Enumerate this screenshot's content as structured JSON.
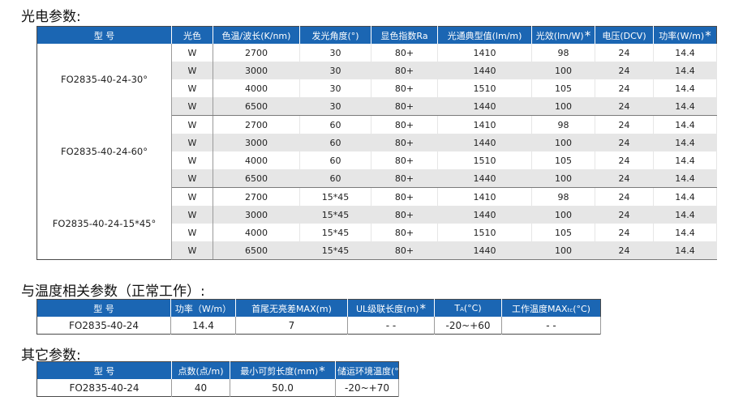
{
  "optical": {
    "title": "光电参数:",
    "headers": [
      "型 号",
      "光色",
      "色温/波长(K/nm)",
      "发光角度(°)",
      "显色指数Ra",
      "光通典型值(lm/m)",
      "光效(lm/W)",
      "电压(DCV)",
      "功率(W/m)"
    ],
    "star_glyph": "*",
    "groups": [
      {
        "model": "FO2835-40-24-30°",
        "rows": [
          [
            "W",
            "2700",
            "30",
            "80+",
            "1410",
            "98",
            "24",
            "14.4"
          ],
          [
            "W",
            "3000",
            "30",
            "80+",
            "1440",
            "100",
            "24",
            "14.4"
          ],
          [
            "W",
            "4000",
            "30",
            "80+",
            "1510",
            "105",
            "24",
            "14.4"
          ],
          [
            "W",
            "6500",
            "30",
            "80+",
            "1440",
            "100",
            "24",
            "14.4"
          ]
        ]
      },
      {
        "model": "FO2835-40-24-60°",
        "rows": [
          [
            "W",
            "2700",
            "60",
            "80+",
            "1410",
            "98",
            "24",
            "14.4"
          ],
          [
            "W",
            "3000",
            "60",
            "80+",
            "1440",
            "100",
            "24",
            "14.4"
          ],
          [
            "W",
            "4000",
            "60",
            "80+",
            "1510",
            "105",
            "24",
            "14.4"
          ],
          [
            "W",
            "6500",
            "60",
            "80+",
            "1440",
            "100",
            "24",
            "14.4"
          ]
        ]
      },
      {
        "model": "FO2835-40-24-15*45°",
        "rows": [
          [
            "W",
            "2700",
            "15*45",
            "80+",
            "1410",
            "98",
            "24",
            "14.4"
          ],
          [
            "W",
            "3000",
            "15*45",
            "80+",
            "1440",
            "100",
            "24",
            "14.4"
          ],
          [
            "W",
            "4000",
            "15*45",
            "80+",
            "1510",
            "105",
            "24",
            "14.4"
          ],
          [
            "W",
            "6500",
            "15*45",
            "80+",
            "1440",
            "100",
            "24",
            "14.4"
          ]
        ]
      }
    ]
  },
  "thermal": {
    "title": "与温度相关参数（正常工作）:",
    "headers": [
      "型 号",
      "功率（W/m）",
      "首尾无亮差MAX(m)",
      "UL级联长度(m)",
      "T",
      "A",
      "(°C)",
      "工作温度MAX",
      "tc",
      "(°C)"
    ],
    "row": [
      "FO2835-40-24",
      "14.4",
      "7",
      "- -",
      "-20~+60",
      "- -"
    ]
  },
  "other": {
    "title": "其它参数:",
    "headers": [
      "型 号",
      "点数(点/m)",
      "最小可剪长度(mm)",
      "储运环境温度(°C)"
    ],
    "row": [
      "FO2835-40-24",
      "40",
      "50.0",
      "-20~+70"
    ]
  }
}
